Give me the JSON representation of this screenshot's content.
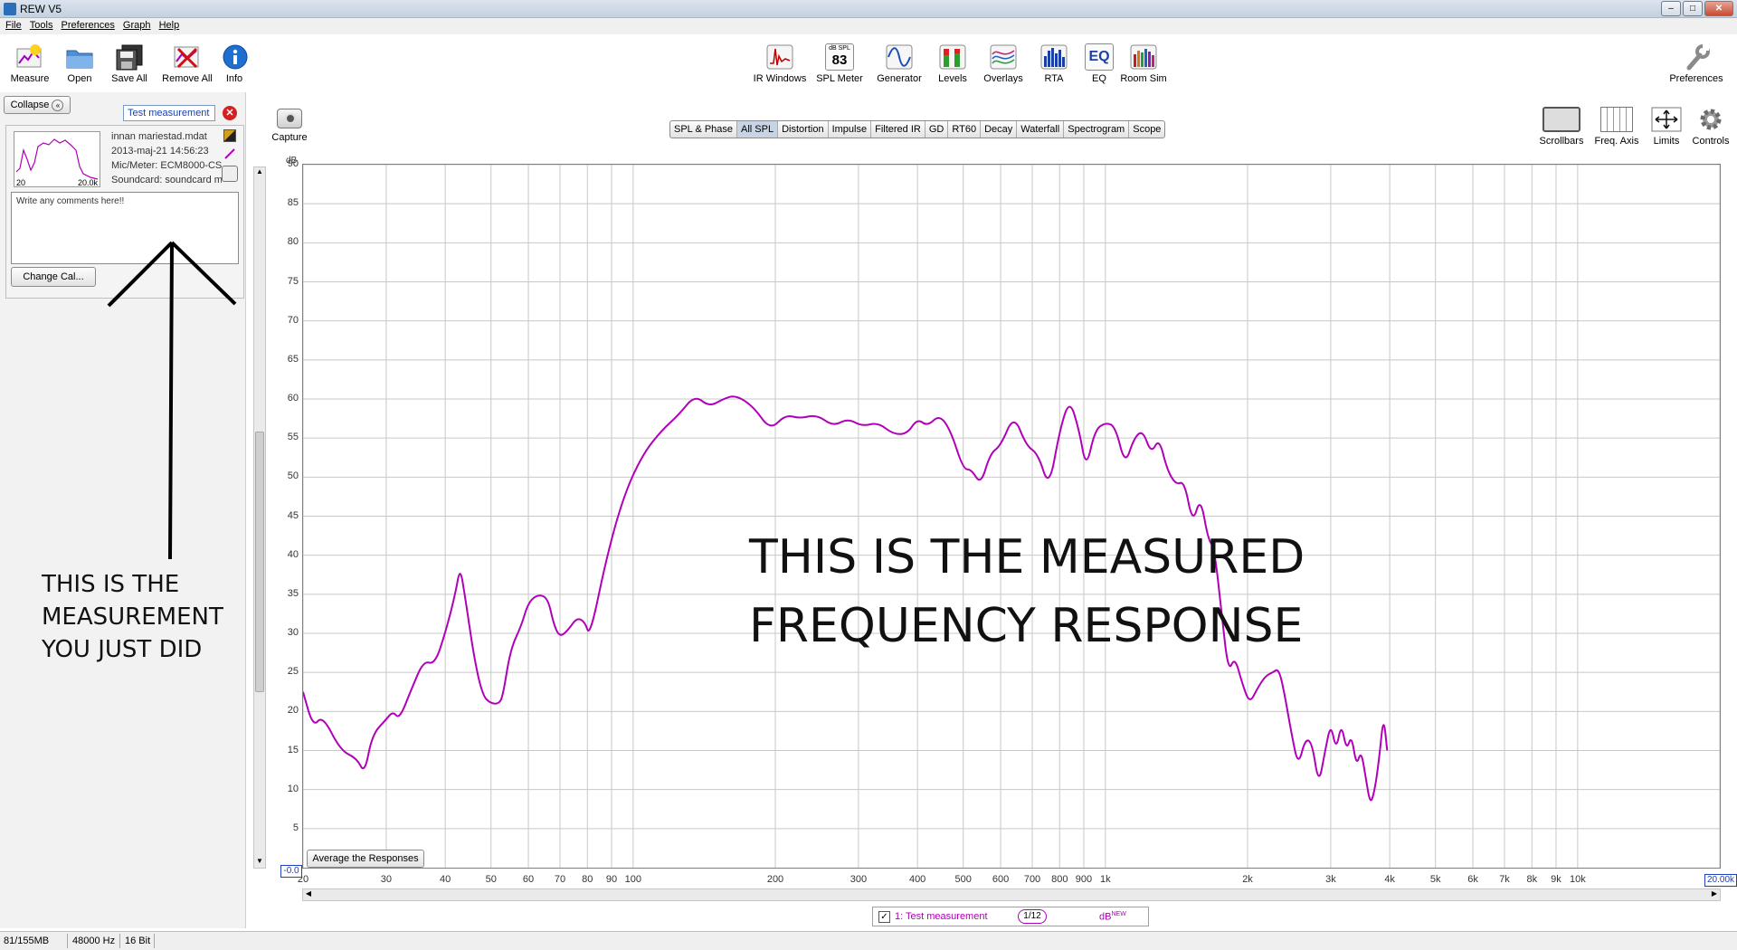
{
  "window": {
    "title": "REW V5"
  },
  "menu": [
    "File",
    "Tools",
    "Preferences",
    "Graph",
    "Help"
  ],
  "toolbar": {
    "left": [
      {
        "label": "Measure",
        "icon": "measure-icon"
      },
      {
        "label": "Open",
        "icon": "folder-icon"
      },
      {
        "label": "Save All",
        "icon": "save-icon"
      },
      {
        "label": "Remove All",
        "icon": "remove-all-icon"
      },
      {
        "label": "Info",
        "icon": "info-icon"
      }
    ],
    "center": [
      {
        "label": "IR Windows",
        "icon": "ir-windows-icon"
      },
      {
        "label": "SPL Meter",
        "icon": "spl-meter-icon",
        "badge_top": "dB SPL",
        "badge_value": "83"
      },
      {
        "label": "Generator",
        "icon": "generator-icon"
      },
      {
        "label": "Levels",
        "icon": "levels-icon"
      },
      {
        "label": "Overlays",
        "icon": "overlays-icon"
      },
      {
        "label": "RTA",
        "icon": "rta-icon"
      },
      {
        "label": "EQ",
        "icon": "eq-icon",
        "badge_value": "EQ"
      },
      {
        "label": "Room Sim",
        "icon": "room-sim-icon"
      }
    ],
    "right": {
      "label": "Preferences",
      "icon": "wrench-icon"
    }
  },
  "left_panel": {
    "collapse_label": "Collapse",
    "measurement": {
      "name": "Test measurement",
      "index": "1",
      "file": "innan mariestad.mdat",
      "date": "2013-maj-21 14:56:23",
      "mic": "Mic/Meter: ECM8000-CS.cal",
      "soundcard": "Soundcard: soundcard mic",
      "thumb_from": "20",
      "thumb_to": "20.0k",
      "comments": "Write any comments here!!"
    },
    "change_cal_label": "Change Cal...",
    "annotation": [
      "THIS IS THE",
      "MEASUREMENT",
      "YOU JUST DID"
    ]
  },
  "graph": {
    "capture_label": "Capture",
    "tabs": [
      "SPL & Phase",
      "All SPL",
      "Distortion",
      "Impulse",
      "Filtered IR",
      "GD",
      "RT60",
      "Decay",
      "Waterfall",
      "Spectrogram",
      "Scope"
    ],
    "active_tab": "All SPL",
    "right_tools": [
      {
        "label": "Scrollbars",
        "icon": "scrollbars-icon"
      },
      {
        "label": "Freq. Axis",
        "icon": "freq-axis-icon"
      },
      {
        "label": "Limits",
        "icon": "limits-icon"
      },
      {
        "label": "Controls",
        "icon": "gear-icon"
      }
    ],
    "average_label": "Average the Responses",
    "annotation": [
      "THIS IS THE MEASURED",
      "FREQUENCY RESPONSE"
    ],
    "x_start_readout": "-0.0",
    "x_end_readout": "20.00k",
    "y_unit": "dB",
    "legend": {
      "checked": true,
      "name": "1: Test measurement",
      "smoothing": "1/12",
      "unit": "dB",
      "unit_sup": "NEW"
    }
  },
  "chart_data": {
    "type": "line",
    "title": "",
    "xlabel": "",
    "ylabel": "dB",
    "x_scale": "log",
    "xlim": [
      20,
      20000
    ],
    "ylim": [
      0,
      90
    ],
    "grid": true,
    "yticks": [
      5,
      10,
      15,
      20,
      25,
      30,
      35,
      40,
      45,
      50,
      55,
      60,
      65,
      70,
      75,
      80,
      85,
      90
    ],
    "xticks": [
      {
        "v": 20,
        "l": "20"
      },
      {
        "v": 30,
        "l": "30"
      },
      {
        "v": 40,
        "l": "40"
      },
      {
        "v": 50,
        "l": "50"
      },
      {
        "v": 60,
        "l": "60"
      },
      {
        "v": 70,
        "l": "70"
      },
      {
        "v": 80,
        "l": "80"
      },
      {
        "v": 90,
        "l": "90"
      },
      {
        "v": 100,
        "l": "100"
      },
      {
        "v": 200,
        "l": "200"
      },
      {
        "v": 300,
        "l": "300"
      },
      {
        "v": 400,
        "l": "400"
      },
      {
        "v": 500,
        "l": "500"
      },
      {
        "v": 600,
        "l": "600"
      },
      {
        "v": 700,
        "l": "700"
      },
      {
        "v": 800,
        "l": "800"
      },
      {
        "v": 900,
        "l": "900"
      },
      {
        "v": 1000,
        "l": "1k"
      },
      {
        "v": 2000,
        "l": "2k"
      },
      {
        "v": 3000,
        "l": "3k"
      },
      {
        "v": 4000,
        "l": "4k"
      },
      {
        "v": 5000,
        "l": "5k"
      },
      {
        "v": 6000,
        "l": "6k"
      },
      {
        "v": 7000,
        "l": "7k"
      },
      {
        "v": 8000,
        "l": "8k"
      },
      {
        "v": 9000,
        "l": "9k"
      },
      {
        "v": 10000,
        "l": "10k"
      },
      {
        "v": 20000,
        "l": "20.00k"
      }
    ],
    "series": [
      {
        "name": "1: Test measurement",
        "color": "#b000b8",
        "points": [
          [
            20,
            22.5
          ],
          [
            21,
            18
          ],
          [
            22,
            19.5
          ],
          [
            24,
            15
          ],
          [
            26,
            14
          ],
          [
            27,
            12
          ],
          [
            28,
            17
          ],
          [
            30,
            19
          ],
          [
            31,
            20
          ],
          [
            32,
            19
          ],
          [
            34,
            23
          ],
          [
            36,
            26.5
          ],
          [
            38,
            26
          ],
          [
            40,
            30
          ],
          [
            42,
            35
          ],
          [
            43,
            38.5
          ],
          [
            44,
            35
          ],
          [
            46,
            27
          ],
          [
            48,
            22
          ],
          [
            50,
            21
          ],
          [
            52,
            21
          ],
          [
            53,
            22
          ],
          [
            55,
            28
          ],
          [
            58,
            31
          ],
          [
            60,
            34
          ],
          [
            63,
            35
          ],
          [
            66,
            34.5
          ],
          [
            68,
            31
          ],
          [
            70,
            29.5
          ],
          [
            73,
            30.5
          ],
          [
            76,
            32
          ],
          [
            79,
            31.5
          ],
          [
            81,
            29.5
          ],
          [
            88,
            40
          ],
          [
            96,
            48
          ],
          [
            105,
            53
          ],
          [
            115,
            56
          ],
          [
            125,
            58
          ],
          [
            135,
            60.5
          ],
          [
            145,
            59
          ],
          [
            155,
            60
          ],
          [
            165,
            60.5
          ],
          [
            180,
            59
          ],
          [
            195,
            56
          ],
          [
            210,
            58
          ],
          [
            225,
            57.5
          ],
          [
            245,
            58
          ],
          [
            265,
            56.5
          ],
          [
            285,
            57.5
          ],
          [
            305,
            56.5
          ],
          [
            330,
            57
          ],
          [
            355,
            55.5
          ],
          [
            380,
            55.5
          ],
          [
            400,
            57.5
          ],
          [
            420,
            56.5
          ],
          [
            445,
            58
          ],
          [
            470,
            56
          ],
          [
            500,
            51
          ],
          [
            520,
            51
          ],
          [
            545,
            49
          ],
          [
            570,
            53
          ],
          [
            600,
            54
          ],
          [
            640,
            58
          ],
          [
            680,
            54
          ],
          [
            720,
            53
          ],
          [
            760,
            48.5
          ],
          [
            800,
            56
          ],
          [
            840,
            60
          ],
          [
            880,
            56
          ],
          [
            910,
            51
          ],
          [
            950,
            56
          ],
          [
            1000,
            57
          ],
          [
            1050,
            56.5
          ],
          [
            1100,
            51.5
          ],
          [
            1150,
            55
          ],
          [
            1200,
            56
          ],
          [
            1250,
            53
          ],
          [
            1300,
            55
          ],
          [
            1350,
            51
          ],
          [
            1410,
            49
          ],
          [
            1470,
            49.5
          ],
          [
            1530,
            44
          ],
          [
            1590,
            47.5
          ],
          [
            1650,
            42
          ],
          [
            1700,
            41
          ],
          [
            1760,
            33
          ],
          [
            1820,
            25
          ],
          [
            1880,
            27
          ],
          [
            1950,
            23.5
          ],
          [
            2020,
            21
          ],
          [
            2100,
            23
          ],
          [
            2180,
            24.5
          ],
          [
            2260,
            25
          ],
          [
            2330,
            25.5
          ],
          [
            2400,
            22
          ],
          [
            2480,
            17
          ],
          [
            2560,
            13
          ],
          [
            2650,
            16.5
          ],
          [
            2740,
            16
          ],
          [
            2830,
            10.5
          ],
          [
            2920,
            15
          ],
          [
            3000,
            18.5
          ],
          [
            3080,
            15
          ],
          [
            3160,
            18.5
          ],
          [
            3240,
            15
          ],
          [
            3320,
            17
          ],
          [
            3400,
            13
          ],
          [
            3480,
            15
          ],
          [
            3560,
            11.5
          ],
          [
            3640,
            8
          ],
          [
            3720,
            10
          ],
          [
            3800,
            14
          ],
          [
            3880,
            19.5
          ],
          [
            3950,
            15
          ]
        ]
      }
    ]
  }
}
